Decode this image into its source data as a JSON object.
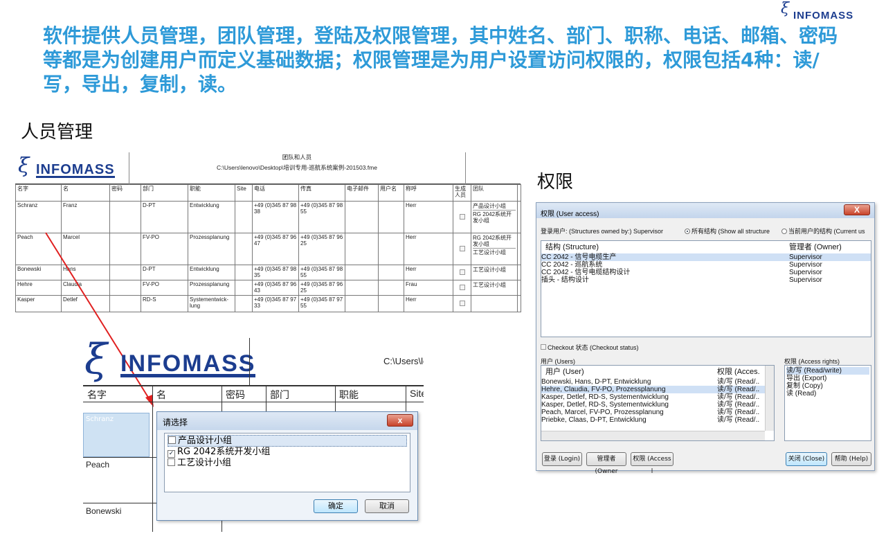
{
  "brand": {
    "name": "INFOMASS"
  },
  "headline": "软件提供人员管理，团队管理，登陆及权限管理，其中姓名、部门、职称、电话、邮箱、密码等都是为创建用户而定义基础数据；权限管理是为用户设置访问权限的，权限包括4种：读/写，导出，复制，读。",
  "section_people": "人员管理",
  "section_rights": "权限",
  "sheet": {
    "title": "团队和人员",
    "path": "C:\\Users\\lenovo\\Desktop\\培训专用-巡航系统案例-201503.fme",
    "columns": [
      "名字",
      "名",
      "密码",
      "部门",
      "职能",
      "Site",
      "电话",
      "传真",
      "电子邮件",
      "用户名",
      "称呼",
      "生成人员",
      "团队"
    ],
    "rows": [
      {
        "last": "Schranz",
        "first": "Franz",
        "dept": "D-PT",
        "func": "Entwicklung",
        "phone": "+49 (0)345 87 98 38",
        "fax": "+49 (0)345 87 98 55",
        "salutation": "Herr",
        "teams": [
          "产品设计小组",
          "RG 2042系统开发小组"
        ]
      },
      {
        "last": "Peach",
        "first": "Marcel",
        "dept": "FV-PO",
        "func": "Prozessplanung",
        "phone": "+49 (0)345 87 96 47",
        "fax": "+49 (0)345 87 96 25",
        "salutation": "Herr",
        "teams": [
          "RG 2042系统开发小组",
          "工艺设计小组"
        ]
      },
      {
        "last": "Bonewski",
        "first": "Hans",
        "dept": "D-PT",
        "func": "Entwicklung",
        "phone": "+49 (0)345 87 98 35",
        "fax": "+49 (0)345 87 98 55",
        "salutation": "Herr",
        "teams": [
          "工艺设计小组"
        ]
      },
      {
        "last": "Hehre",
        "first": "Claudia",
        "dept": "FV-PO",
        "func": "Prozessplanung",
        "phone": "+49 (0)345 87 96 43",
        "fax": "+49 (0)345 87 96 25",
        "salutation": "Frau",
        "teams": [
          "工艺设计小组"
        ]
      },
      {
        "last": "Kasper",
        "first": "Detlef",
        "dept": "RD-S",
        "func": "Systementwick-lung",
        "phone": "+49 (0)345 87 97 33",
        "fax": "+49 (0)345 87 97 55",
        "salutation": "Herr",
        "teams": []
      }
    ]
  },
  "zoom": {
    "path": "C:\\Users\\le",
    "columns": [
      "名字",
      "名",
      "密码",
      "部门",
      "职能",
      "Site"
    ],
    "selected": "Schranz",
    "rows": [
      "Peach",
      "Bonewski"
    ]
  },
  "picker": {
    "title": "请选择",
    "items": [
      {
        "label": "产品设计小组",
        "checked": false
      },
      {
        "label": "RG 2042系统开发小组",
        "checked": true
      },
      {
        "label": "工艺设计小组",
        "checked": false
      }
    ],
    "ok": "确定",
    "cancel": "取消",
    "close": "x"
  },
  "access": {
    "title": "权限 (User access)",
    "login_user": "登录用户: (Structures owned by:) Supervisor",
    "radio_all": "所有结构 (Show all structure",
    "radio_current": "当前用户的结构 (Current us",
    "structure_head": "结构 (Structure)",
    "owner_head": "管理者 (Owner)",
    "structures": [
      {
        "name": "CC 2042 - 信号电缆生产",
        "owner": "Supervisor"
      },
      {
        "name": "CC 2042 - 巡航系统",
        "owner": "Supervisor"
      },
      {
        "name": "CC 2042 - 信号电缆结构设计",
        "owner": "Supervisor"
      },
      {
        "name": "插头 - 结构设计",
        "owner": "Supervisor"
      }
    ],
    "checkout": "Checkout 状态 (Checkout status)",
    "users_label": "用户 (Users)",
    "user_head": "用户 (User)",
    "rights_head": "权限 (Acces.",
    "users": [
      {
        "name": "Bonewski, Hans, D-PT, Entwicklung",
        "right": "读/写 (Read/.."
      },
      {
        "name": "Hehre, Claudia, FV-PO, Prozessplanung",
        "right": "读/写 (Read/.."
      },
      {
        "name": "Kasper, Detlef, RD-S, Systementwicklung",
        "right": "读/写 (Read/.."
      },
      {
        "name": "Kasper, Detlef, RD-S, Systementwicklung",
        "right": "读/写 (Read/.."
      },
      {
        "name": "Peach, Marcel, FV-PO, Prozessplanung",
        "right": "读/写 (Read/.."
      },
      {
        "name": "Priebke, Claas, D-PT, Entwicklung",
        "right": "读/写 (Read/.."
      }
    ],
    "rights_label": "权限 (Access rights)",
    "rights": [
      "读/写 (Read/write)",
      "导出 (Export)",
      "复制 (Copy)",
      "读 (Read)"
    ],
    "btn_login": "登录 (Login)",
    "btn_owner": "管理者 (Owner",
    "btn_access": "权限 (Access l",
    "btn_close": "关闭 (Close)",
    "btn_help": "帮助 (Help)",
    "close": "X"
  }
}
